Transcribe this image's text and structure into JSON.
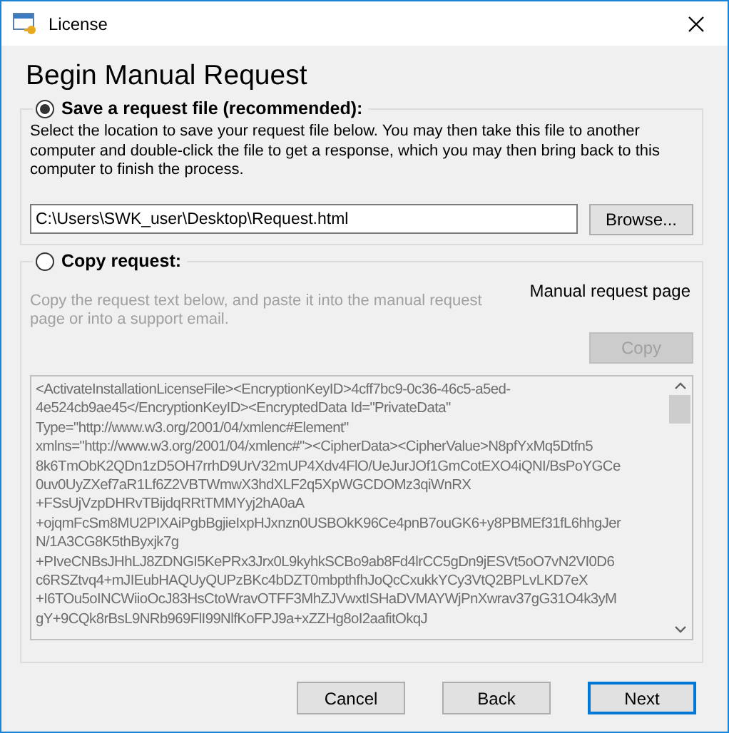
{
  "window": {
    "title": "License"
  },
  "heading": "Begin Manual Request",
  "options": [
    {
      "kind": "save",
      "label": "Save a request file (recommended):",
      "selected": true,
      "description": "Select the location to save your request file below.  You may then take this file to another computer and double-click the file to get a response, which you may then bring back to this computer to finish the process.",
      "path": "C:\\Users\\SWK_user\\Desktop\\Request.html",
      "button": "Browse..."
    },
    {
      "kind": "copy",
      "label": "Copy request:",
      "selected": false,
      "description": "Copy the request text below, and paste it into the manual request page or into a support email.",
      "link": "Manual request page",
      "button": "Copy",
      "disabled": true,
      "request_lines": [
        "<ActivateInstallationLicenseFile><EncryptionKeyID>4cff7bc9-0c36-46c5-a5ed-",
        "4e524cb9ae45</EncryptionKeyID><EncryptedData Id=\"PrivateData\"",
        "Type=\"http://www.w3.org/2001/04/xmlenc#Element\"",
        "xmlns=\"http://www.w3.org/2001/04/xmlenc#\"><CipherData><CipherValue>N8pfYxMq5Dtfn5",
        "8k6TmObK2QDn1zD5OH7rrhD9UrV32mUP4Xdv4FlO/UeJurJOf1GmCotEXO4iQNI/BsPoYGCe",
        "0uv0UyZXef7aR1Lf6Z2VBTWmwX3hdXLF2q5XpWGCDOMz3qiWnRX",
        "+FSsUjVzpDHRvTBijdqRRtTMMYyj2hA0aA",
        "+ojqmFcSm8MU2PIXAiPgbBgjieIxpHJxnzn0USBOkK96Ce4pnB7ouGK6+y8PBMEf31fL6hhgJer",
        "N/1A3CG8K5thByxjk7g",
        "+PIveCNBsJHhLJ8ZDNGI5KePRx3Jrx0L9kyhkSCBo9ab8Fd4lrCC5gDn9jESVt5oO7vN2VI0D6",
        "c6RSZtvq4+mJIEubHAQUyQUPzBKc4bDZT0mbpthfhJoQcCxukkYCy3VtQ2BPLvLKD7eX",
        "+I6TOu5oINCWiioOcJ83HsCtoWravOTFF3MhZJVwxtISHaDVMAYWjPnXwrav37gG31O4k3yM",
        "gY+9CQk8rBsL9NRb969FlI99NlfKoFPJ9a+xZZHg8oI2aafitOkqJ"
      ]
    }
  ],
  "buttons": [
    {
      "label": "Cancel",
      "default": false
    },
    {
      "label": "Back",
      "default": false
    },
    {
      "label": "Next",
      "default": true
    }
  ]
}
